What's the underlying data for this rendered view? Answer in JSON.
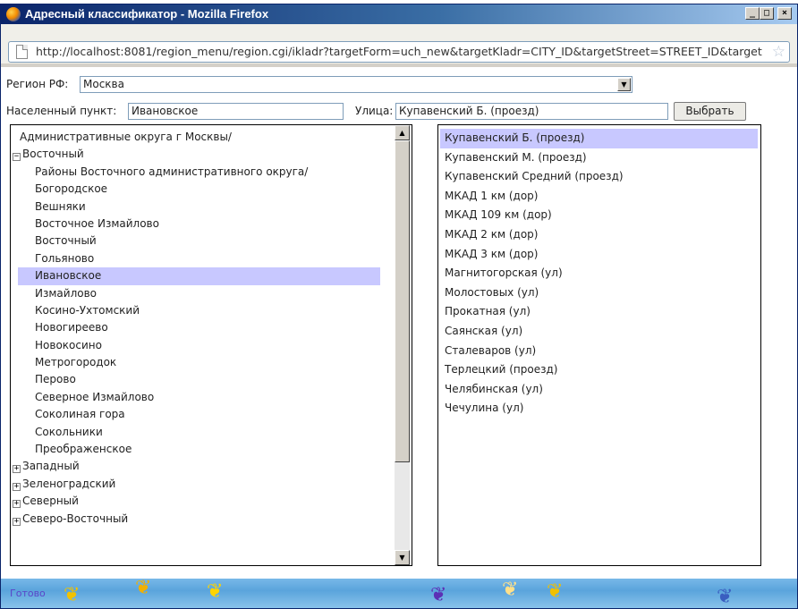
{
  "window": {
    "title": "Адресный классификатор - Mozilla Firefox",
    "min_label": "_",
    "max_label": "□",
    "close_label": "×"
  },
  "urlbar": {
    "url": "http://localhost:8081/region_menu/region.cgi/ikladr?targetForm=uch_new&targetKladr=CITY_ID&targetStreet=STREET_ID&target"
  },
  "form": {
    "region_label": "Регион РФ:",
    "region_value": "Москва",
    "locality_label": "Населенный пункт:",
    "locality_value": "Ивановское",
    "street_label": "Улица:",
    "street_value": "Купавенский Б. (проезд)",
    "select_button": "Выбрать"
  },
  "tree": {
    "rows": [
      {
        "text": "Административные округа г Москвы/",
        "kind": "top"
      },
      {
        "text": "Восточный",
        "kind": "group",
        "toggle": "−"
      },
      {
        "text": "Районы Восточного административного округа/",
        "kind": "indent"
      },
      {
        "text": "Богородское",
        "kind": "indent"
      },
      {
        "text": "Вешняки",
        "kind": "indent"
      },
      {
        "text": "Восточное Измайлово",
        "kind": "indent"
      },
      {
        "text": "Восточный",
        "kind": "indent"
      },
      {
        "text": "Гольяново",
        "kind": "indent"
      },
      {
        "text": "Ивановское",
        "kind": "indent",
        "selected": true
      },
      {
        "text": "Измайлово",
        "kind": "indent"
      },
      {
        "text": "Косино-Ухтомский",
        "kind": "indent"
      },
      {
        "text": "Новогиреево",
        "kind": "indent"
      },
      {
        "text": "Новокосино",
        "kind": "indent"
      },
      {
        "text": "Метрогородок",
        "kind": "indent"
      },
      {
        "text": "Перово",
        "kind": "indent"
      },
      {
        "text": "Северное Измайлово",
        "kind": "indent"
      },
      {
        "text": "Соколиная гора",
        "kind": "indent"
      },
      {
        "text": "Сокольники",
        "kind": "indent"
      },
      {
        "text": "Преображенское",
        "kind": "indent"
      },
      {
        "text": "Западный",
        "kind": "group",
        "toggle": "+"
      },
      {
        "text": "Зеленоградский",
        "kind": "group",
        "toggle": "+"
      },
      {
        "text": "Северный",
        "kind": "group",
        "toggle": "+"
      },
      {
        "text": "Северо-Восточный",
        "kind": "group",
        "toggle": "+"
      }
    ]
  },
  "streets": {
    "rows": [
      {
        "text": "Купавенский Б. (проезд)",
        "selected": true
      },
      {
        "text": "Купавенский М. (проезд)"
      },
      {
        "text": "Купавенский Средний (проезд)"
      },
      {
        "text": "МКАД 1 км (дор)"
      },
      {
        "text": "МКАД 109 км (дор)"
      },
      {
        "text": "МКАД 2 км (дор)"
      },
      {
        "text": "МКАД 3 км (дор)"
      },
      {
        "text": "Магнитогорская (ул)"
      },
      {
        "text": "Молостовых (ул)"
      },
      {
        "text": "Прокатная (ул)"
      },
      {
        "text": "Саянская (ул)"
      },
      {
        "text": "Сталеваров (ул)"
      },
      {
        "text": "Терлецкий (проезд)"
      },
      {
        "text": "Челябинская (ул)"
      },
      {
        "text": "Чечулина (ул)"
      }
    ]
  },
  "statusbar": {
    "text": "Готово"
  },
  "icons": {
    "app": "firefox-icon",
    "page": "page-icon",
    "bookmark": "star-icon",
    "scroll_up": "scroll-up-icon",
    "scroll_down": "scroll-down-icon",
    "dropdown": "chevron-down-icon"
  }
}
